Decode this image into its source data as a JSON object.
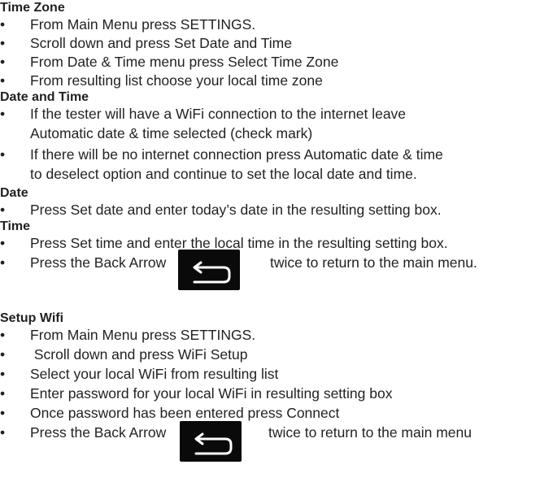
{
  "sections": {
    "time_zone": {
      "title": "Time Zone",
      "items": [
        "From Main Menu press SETTINGS.",
        "Scroll down and press Set Date and Time",
        "From Date & Time menu press Select Time Zone",
        "From resulting list choose your local time zone"
      ]
    },
    "date_and_time": {
      "title": "Date and Time",
      "items": [
        {
          "line1": "If the tester will have a WiFi connection to the internet leave",
          "line2": "Automatic date & time selected (check mark)"
        },
        {
          "line1": "If there will be no internet connection press Automatic date & time",
          "line2": "to deselect option and continue to set the local date and time."
        }
      ]
    },
    "date": {
      "title": "Date",
      "items": [
        "Press Set date and enter today’s date in the resulting setting box."
      ]
    },
    "time": {
      "title": "Time",
      "items": [
        "Press Set time and enter the local time in the resulting setting box."
      ],
      "back_item": {
        "before": "Press the Back Arrow",
        "after": "twice to return to the main menu."
      }
    },
    "setup_wifi": {
      "title": "Setup Wifi",
      "items": [
        "From Main Menu press SETTINGS.",
        " Scroll down and press WiFi Setup",
        "Select your local WiFi from resulting list",
        "Enter password for your local WiFi in resulting setting box",
        "Once password has been entered press Connect"
      ],
      "back_item": {
        "before": "Press the Back Arrow",
        "after": "twice to return to the main menu"
      }
    }
  },
  "bullet_char": "•",
  "icons": {
    "back_arrow": "back-arrow-icon"
  },
  "colors": {
    "text": "#231f20",
    "icon_bg": "#0a0a0a",
    "icon_stroke": "#ffffff"
  }
}
